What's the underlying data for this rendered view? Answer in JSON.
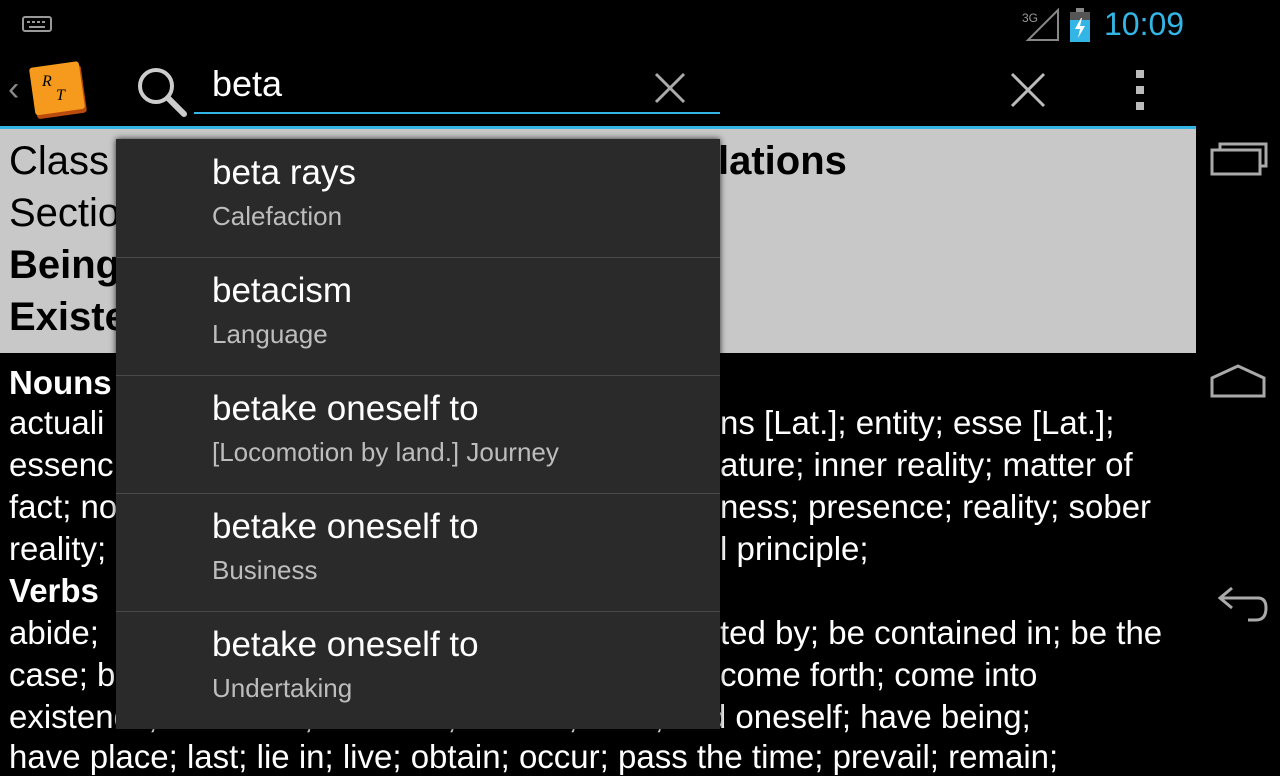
{
  "status_bar": {
    "time": "10:09",
    "network": "3G"
  },
  "search": {
    "query": "beta"
  },
  "header": {
    "line1_left": "Class",
    "line1_right": "lations",
    "line2_left": "Sectio",
    "line3_left": "Being",
    "line4_left": "Existe"
  },
  "content_lines": [
    {
      "left": "Nouns",
      "right": "",
      "bold": true
    },
    {
      "left": "actuali",
      "right": "ns [Lat.]; entity; esse [Lat.];",
      "bold": false
    },
    {
      "left": "essenc",
      "right": "ature; inner reality; matter of",
      "bold": false
    },
    {
      "left": "fact; no",
      "right": "ness; presence; reality; sober",
      "bold": false
    },
    {
      "left": "reality;",
      "right": "l principle;",
      "bold": false
    },
    {
      "left": "Verbs",
      "right": "",
      "bold": true
    },
    {
      "left": "abide;",
      "right": "ted by; be contained in; be the",
      "bold": false
    },
    {
      "left": "case; b",
      "right": "come forth; come into",
      "bold": false
    },
    {
      "left": "existence; consist in; continue; endure; exist; find oneself; have being;",
      "right": "",
      "bold": false
    },
    {
      "left": "have place; last; lie in; live; obtain; occur; pass the time; prevail; remain;",
      "right": "",
      "bold": false
    }
  ],
  "suggestions": [
    {
      "title": "beta rays",
      "category": "Calefaction"
    },
    {
      "title": "betacism",
      "category": "Language"
    },
    {
      "title": "betake oneself to",
      "category": "[Locomotion by land.] Journey"
    },
    {
      "title": "betake oneself to",
      "category": "Business"
    },
    {
      "title": "betake oneself to",
      "category": "Undertaking"
    }
  ],
  "icons": {
    "keyboard": "keyboard-icon",
    "signal": "signal-icon",
    "battery": "battery-charging-icon",
    "app": "app-logo-icon",
    "search": "search-icon",
    "clear": "clear-icon",
    "close": "close-icon",
    "overflow": "overflow-menu-icon",
    "recent": "recent-apps-icon",
    "home": "home-icon",
    "back": "back-icon"
  },
  "colors": {
    "accent": "#33b5e5",
    "header_bg": "#c8c8c8",
    "dropdown_bg": "#2a2a2a",
    "secondary_text": "#bdbdbd"
  }
}
